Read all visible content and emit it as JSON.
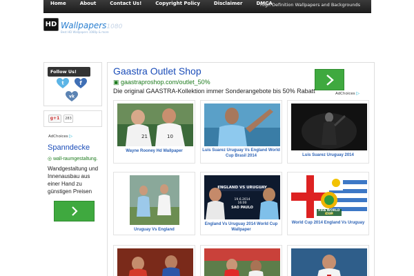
{
  "nav": {
    "items": [
      "Home",
      "About",
      "Contact Us!",
      "Copyright Policy",
      "Disclaimer",
      "DMCA"
    ],
    "tagline": "High Definition Wallpapers and Backgrounds"
  },
  "logo": {
    "badge": "HD",
    "word": "Wallpapers",
    "suffix": "1080",
    "sub": "Best HD Wallpapers 1080p & more"
  },
  "sidebar": {
    "follow_title": "Follow Us!",
    "social_icons": [
      "twitter-icon",
      "facebook-icon",
      "vk-icon"
    ],
    "gplus_label": "g+1",
    "gplus_count": "283",
    "ad": {
      "adchoices": "AdChoices",
      "title": "Spanndecke",
      "url": "wall-raumgestaltung.",
      "desc": "Wandgestaltung und Innenausbau aus einer Hand zu günstigen Preisen"
    }
  },
  "main_ad": {
    "title": "Gaastra Outlet Shop",
    "url": "gaastraproshop.com/outlet_50%",
    "desc": "Die original GAASTRA-Kollektion immer Sonderangebote bis 50% Rabatt",
    "adchoices": "AdChoices"
  },
  "thumbs": [
    {
      "caption": "Wayne Rooney Hd Wallpaper"
    },
    {
      "caption": "Luis Suarez Uruguay Vs England World Cup Brasil 2014"
    },
    {
      "caption": "Luis Suarez Uruguay 2014"
    },
    {
      "caption": "Uruguay Vs England"
    },
    {
      "caption": "England Vs Uruguay 2014 World Cup Wallpaper",
      "banner": "ENGLAND VS URUGUAY",
      "date": "19.6.2014",
      "time": "16:00",
      "city": "SAO PAULO"
    },
    {
      "caption": "World Cup 2014 England Vs Uruguay",
      "badge": "FIFA WORLD CUP",
      "badge_sub": "Brasil"
    },
    {
      "caption": ""
    },
    {
      "caption": ""
    },
    {
      "caption": ""
    }
  ],
  "colors": {
    "accent_blue": "#2c62b5",
    "ad_green": "#3fa93f",
    "nav_bg": "#2a2a2a"
  }
}
